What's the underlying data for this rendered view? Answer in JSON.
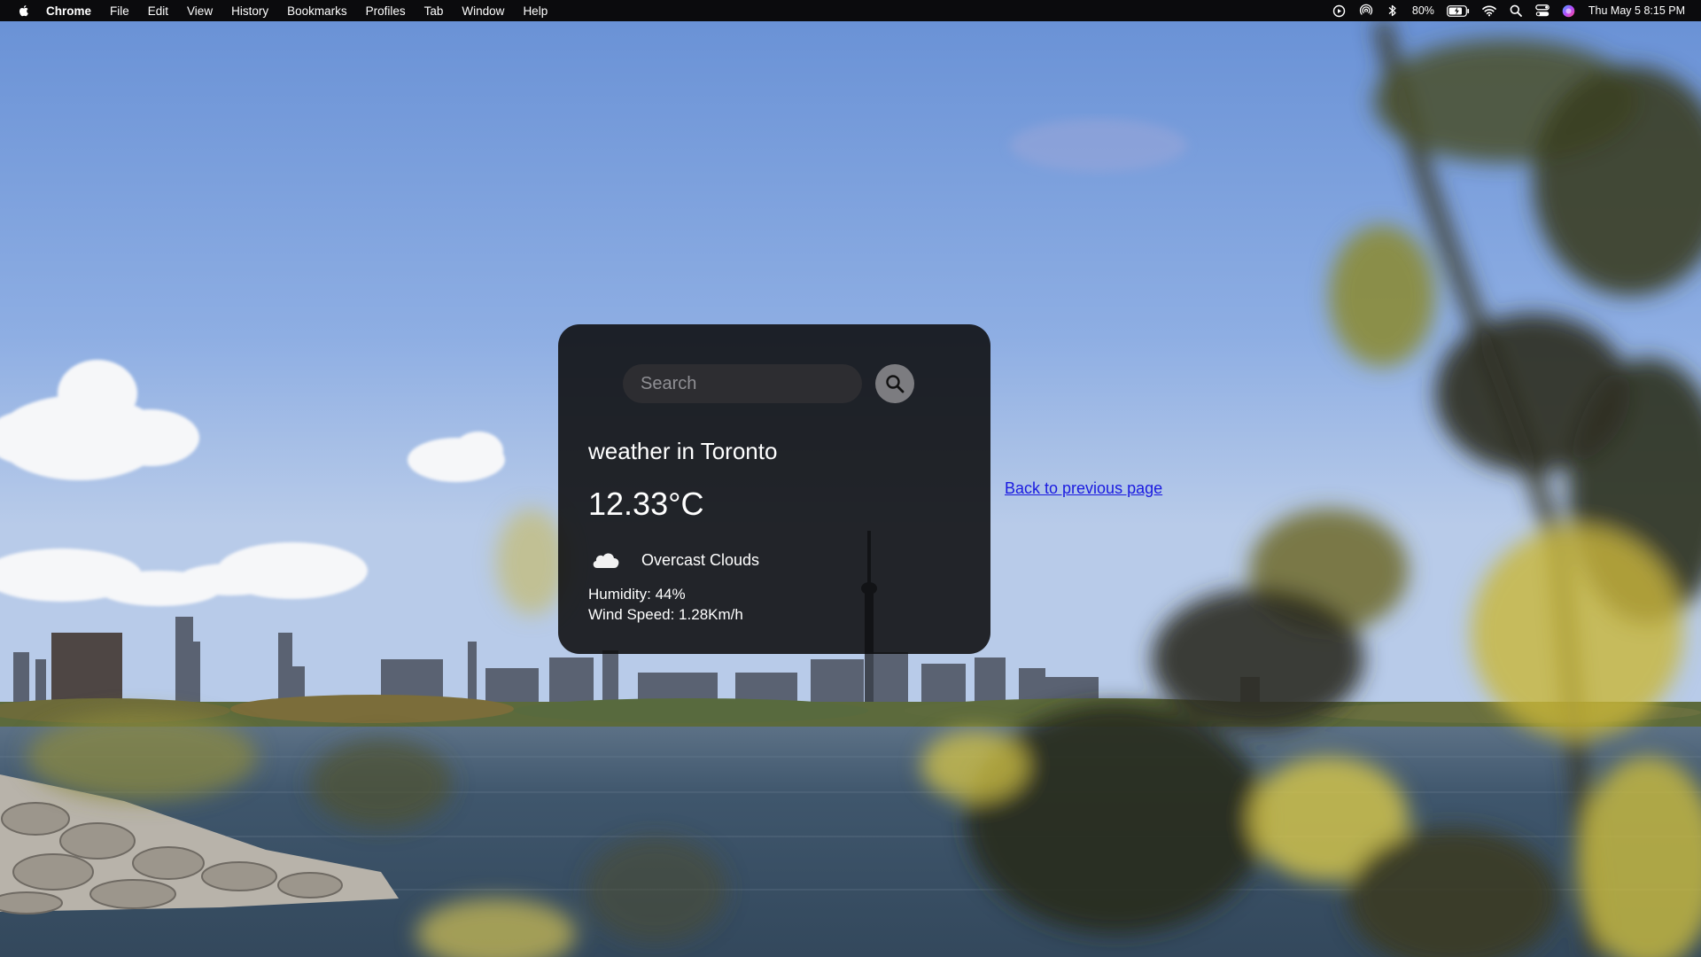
{
  "menubar": {
    "app_name": "Chrome",
    "items": [
      "File",
      "Edit",
      "View",
      "History",
      "Bookmarks",
      "Profiles",
      "Tab",
      "Window",
      "Help"
    ],
    "battery_percent": "80%",
    "datetime": "Thu May 5  8:15 PM"
  },
  "weather": {
    "search_placeholder": "Search",
    "city_title": "weather in Toronto",
    "temperature": "12.33°C",
    "condition": "Overcast Clouds",
    "condition_icon": "cloud-icon",
    "humidity": "Humidity: 44%",
    "wind": "Wind Speed: 1.28Km/h"
  },
  "back_link": "Back to previous page",
  "colors": {
    "card_background": "#0c0c0e",
    "search_field": "#2d2d31",
    "search_button": "#7c7c80",
    "link": "#1a1ae0",
    "sky": "#7fa3dd",
    "water": "#3d5468"
  }
}
